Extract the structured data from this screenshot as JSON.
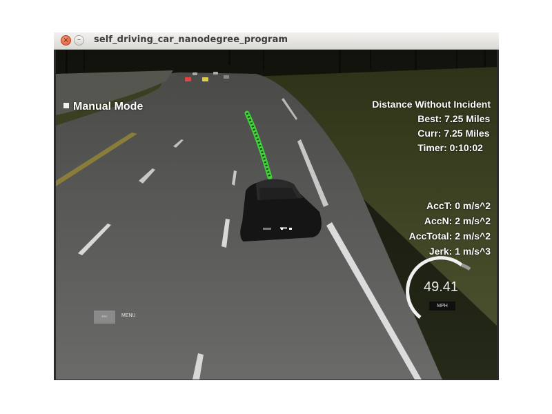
{
  "window": {
    "title": "self_driving_car_nanodegree_program",
    "close_glyph": "×",
    "minimize_glyph": "–"
  },
  "hud": {
    "mode": "Manual Mode",
    "distance_heading": "Distance Without Incident",
    "best": "Best: 7.25 Miles",
    "curr": "Curr: 7.25 Miles",
    "timer": "Timer: 0:10:02",
    "acc_t": "AccT: 0 m/s^2",
    "acc_n": "AccN: 2 m/s^2",
    "acc_total": "AccTotal: 2 m/s^2",
    "jerk": "Jerk: 1 m/s^3"
  },
  "speedometer": {
    "value": "49.41",
    "unit": "MPH"
  },
  "menu": {
    "esc_label": "esc",
    "label": "MENU"
  },
  "colors": {
    "path": "#3fd13a",
    "road": "#5e5f5c",
    "grass": "#3e4424",
    "gauge": "#cfcfcf"
  },
  "icons": {
    "close": "close-icon",
    "minimize": "minimize-icon",
    "car": "ego-car-icon"
  }
}
